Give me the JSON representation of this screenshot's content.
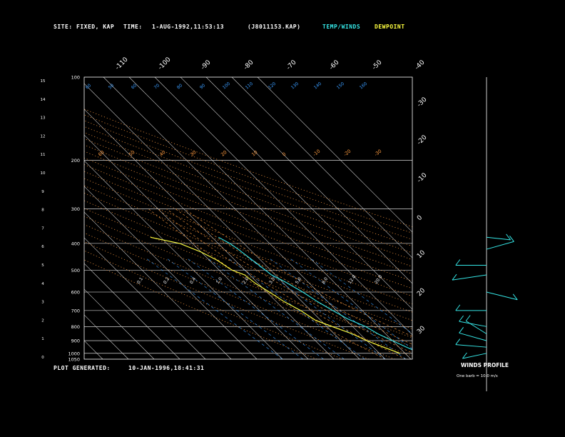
{
  "header": {
    "site_label": "SITE:",
    "site_value": "FIXED, KAP",
    "time_label": "TIME:",
    "time_value": "1-AUG-1992,11:53:13",
    "file_value": "(J8011153.KAP)",
    "legend_temp": "TEMP/WINDS",
    "legend_dew": "DEWPOINT"
  },
  "footer": {
    "generated_label": "PLOT GENERATED:",
    "generated_value": "10-JAN-1996,18:41:31"
  },
  "winds": {
    "title": "WINDS PROFILE",
    "note": "One barb = 10.0 m/s"
  },
  "colors": {
    "background": "#000000",
    "frame": "#ffffff",
    "isotherm": "#d0d0d0",
    "adiabat": "#ff9c40",
    "moist": "#ff9c40",
    "mixing": "#3a9cff",
    "temp": "#35e6e6",
    "dewpoint": "#ffff40",
    "wind": "#35e6e6"
  },
  "chart_data": {
    "type": "line",
    "pressure_levels": [
      400,
      200,
      300,
      400,
      500,
      600,
      700,
      800,
      900,
      1000,
      1050
    ],
    "pressure_labels": [
      "100",
      "200",
      "300",
      "400",
      "500",
      "600",
      "700",
      "800",
      "900",
      "1000",
      "1050"
    ],
    "height_labels": [
      "15",
      "14",
      "13",
      "12",
      "11",
      "10",
      "9",
      "8",
      "7",
      "6",
      "5",
      "4",
      "3",
      "2",
      "1",
      "0"
    ],
    "top_temp_labels": [
      "-110",
      "-100",
      "-90",
      "-80",
      "-70",
      "-60",
      "-50",
      "-40"
    ],
    "right_temp_labels": [
      "-30",
      "-20",
      "-10",
      "0",
      "10",
      "20",
      "30"
    ],
    "adiabat_labels": [
      "60",
      "50",
      "40",
      "30",
      "20",
      "10",
      "0",
      "-10",
      "-20",
      "-30"
    ],
    "adiabat_labels_top": [
      "60",
      "50",
      "60",
      "70",
      "80",
      "90",
      "100",
      "110",
      "120",
      "130",
      "140",
      "150",
      "160"
    ],
    "mixing_labels": [
      "0.1",
      "0.2",
      "0.4",
      "1.0",
      "2.0",
      "3.5",
      "5.0",
      "8.0",
      "12.0",
      "20.0"
    ],
    "series": [
      {
        "name": "TEMP/WINDS",
        "points": [
          [
            380,
            -17.5
          ],
          [
            400,
            -15.5
          ],
          [
            420,
            -14.5
          ],
          [
            450,
            -13.5
          ],
          [
            500,
            -12
          ],
          [
            520,
            -11.5
          ],
          [
            550,
            -9
          ],
          [
            600,
            -6
          ],
          [
            650,
            -4
          ],
          [
            700,
            -1.5
          ],
          [
            750,
            1
          ],
          [
            800,
            5
          ],
          [
            850,
            7
          ],
          [
            900,
            10
          ],
          [
            950,
            13
          ],
          [
            1000,
            16
          ]
        ]
      },
      {
        "name": "DEWPOINT",
        "points": [
          [
            380,
            -44
          ],
          [
            400,
            -35
          ],
          [
            430,
            -30
          ],
          [
            460,
            -27
          ],
          [
            500,
            -25
          ],
          [
            520,
            -22
          ],
          [
            560,
            -21
          ],
          [
            600,
            -19
          ],
          [
            650,
            -17
          ],
          [
            700,
            -14
          ],
          [
            760,
            -12
          ],
          [
            800,
            -8
          ],
          [
            850,
            -3
          ],
          [
            900,
            0
          ],
          [
            950,
            4
          ],
          [
            1000,
            8
          ]
        ]
      }
    ],
    "winds": [
      {
        "p": 1000,
        "u": -7,
        "v": 2
      },
      {
        "p": 950,
        "u": -9,
        "v": -1
      },
      {
        "p": 900,
        "u": -8,
        "v": -3
      },
      {
        "p": 850,
        "u": -6,
        "v": -5
      },
      {
        "p": 800,
        "u": -8,
        "v": -2
      },
      {
        "p": 700,
        "u": -9,
        "v": 0
      },
      {
        "p": 600,
        "u": 9,
        "v": 3
      },
      {
        "p": 520,
        "u": -10,
        "v": 2
      },
      {
        "p": 480,
        "u": -9,
        "v": 0
      },
      {
        "p": 420,
        "u": 8,
        "v": -3
      },
      {
        "p": 380,
        "u": 7,
        "v": 1
      }
    ],
    "xlim": [
      -45,
      40
    ],
    "ylim": [
      1050,
      100
    ]
  }
}
